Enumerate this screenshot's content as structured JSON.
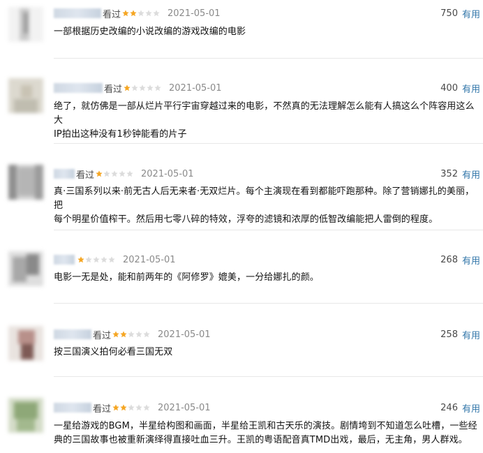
{
  "reviews": [
    {
      "watched_label": "看过",
      "rating": 2,
      "date": "2021-05-01",
      "votes": "750",
      "useful_label": "有用",
      "lines": [
        "一部根据历史改编的小说改编的游戏改编的电影"
      ]
    },
    {
      "watched_label": "看过",
      "rating": 1,
      "date": "2021-05-01",
      "votes": "400",
      "useful_label": "有用",
      "lines": [
        "绝了，就仿佛是一部从烂片平行宇宙穿越过来的电影，不然真的无法理解怎么能有人搞这么个阵容用这么大",
        "IP拍出这种没有1秒钟能看的片子"
      ]
    },
    {
      "watched_label": "看过",
      "rating": 1,
      "date": "2021-05-01",
      "votes": "352",
      "useful_label": "有用",
      "lines": [
        "真·三国系列以来·前无古人后无来者·无双烂片。每个主演现在看到都能吓跑那种。除了营销娜扎的美丽，把",
        "每个明星价值榨干。然后用七零八碎的特效，浮夸的滤镜和浓厚的低智改编能把人雷倒的程度。"
      ]
    },
    {
      "watched_label": "",
      "rating": 1,
      "date": "2021-05-01",
      "votes": "268",
      "useful_label": "有用",
      "lines": [
        "电影一无是处，能和前两年的《阿修罗》媲美，一分给娜扎的颜。"
      ]
    },
    {
      "watched_label": "看过",
      "rating": 2,
      "date": "2021-05-01",
      "votes": "258",
      "useful_label": "有用",
      "lines": [
        "按三国演义拍何必看三国无双"
      ]
    },
    {
      "watched_label": "看过",
      "rating": 2,
      "date": "2021-05-01",
      "votes": "246",
      "useful_label": "有用",
      "lines": [
        "一星给游戏的BGM，半星给构图和画面，半星给王凯和古天乐的演技。剧情垮到不知道怎么吐槽，一些经",
        "典的三国故事也被重新演绎得直接吐血三升。王凯的粤语配音真TMD出戏，最后，无主角，男人群戏。"
      ]
    }
  ],
  "colors": {
    "star_filled": "#f5a623",
    "star_empty": "#dcdcdc",
    "link": "#3377aa",
    "date": "#8a8a8a"
  }
}
